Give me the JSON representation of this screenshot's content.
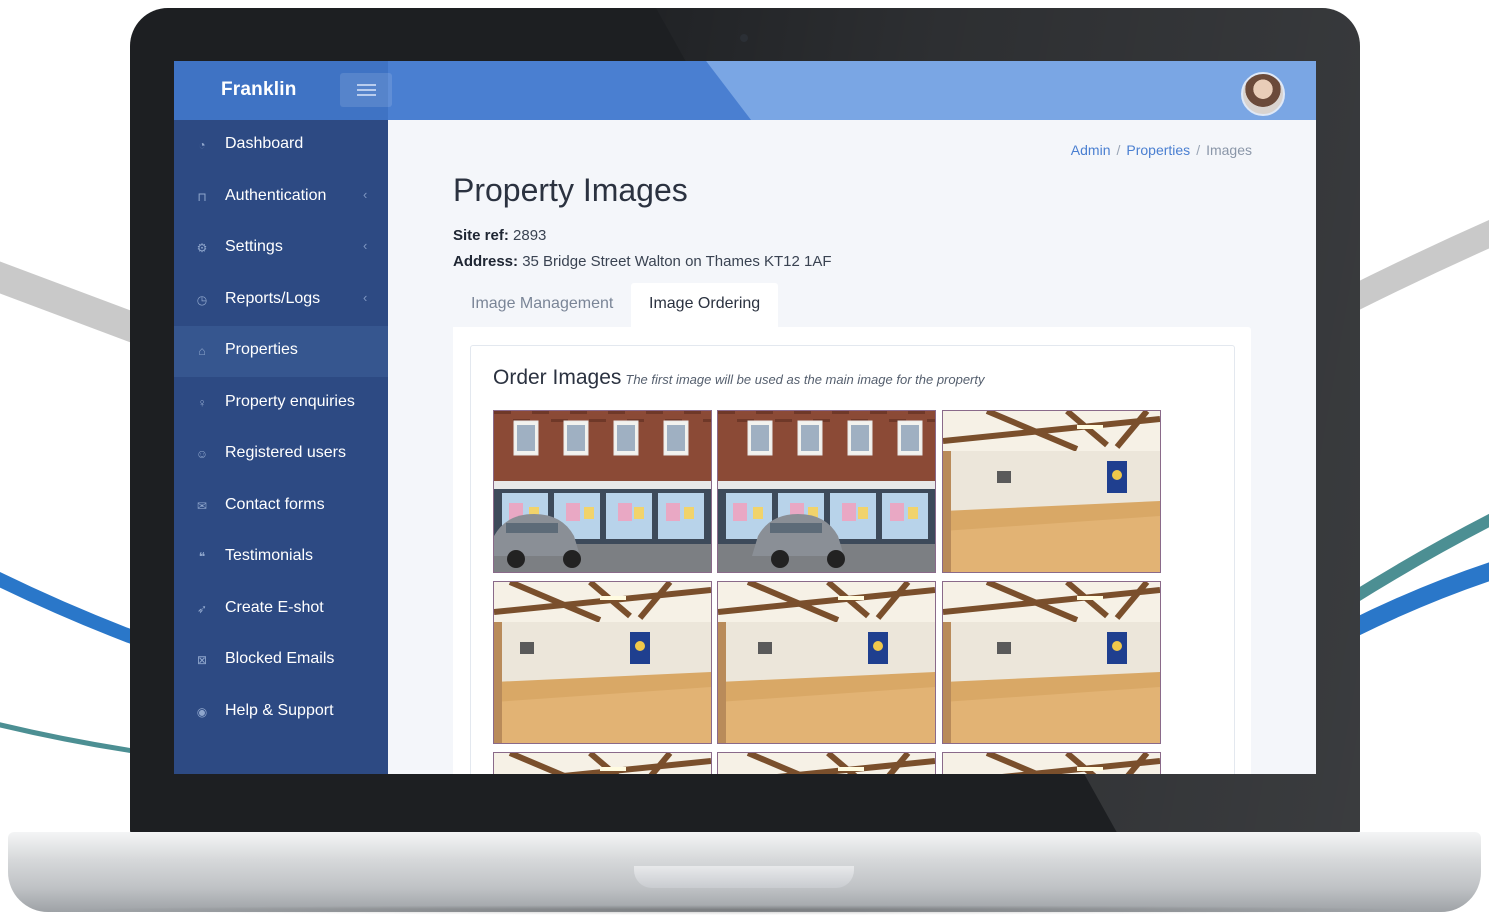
{
  "app": {
    "brand": "Franklin"
  },
  "sidebar": {
    "items": [
      {
        "label": "Dashboard",
        "icon": "dashboard-icon",
        "glyph": "◔",
        "chevron": false,
        "active": false
      },
      {
        "label": "Authentication",
        "icon": "lock-icon",
        "glyph": "⊓",
        "chevron": true,
        "active": false
      },
      {
        "label": "Settings",
        "icon": "gear-icon",
        "glyph": "⚙",
        "chevron": true,
        "active": false
      },
      {
        "label": "Reports/Logs",
        "icon": "clock-icon",
        "glyph": "◷",
        "chevron": true,
        "active": false
      },
      {
        "label": "Properties",
        "icon": "home-icon",
        "glyph": "⌂",
        "chevron": false,
        "active": true
      },
      {
        "label": "Property enquiries",
        "icon": "lightbulb-icon",
        "glyph": "♀",
        "chevron": false,
        "active": false
      },
      {
        "label": "Registered users",
        "icon": "smiley-icon",
        "glyph": "☺",
        "chevron": false,
        "active": false
      },
      {
        "label": "Contact forms",
        "icon": "envelope-icon",
        "glyph": "✉",
        "chevron": false,
        "active": false
      },
      {
        "label": "Testimonials",
        "icon": "quote-icon",
        "glyph": "❝",
        "chevron": false,
        "active": false
      },
      {
        "label": "Create E-shot",
        "icon": "rocket-icon",
        "glyph": "➶",
        "chevron": false,
        "active": false
      },
      {
        "label": "Blocked Emails",
        "icon": "mail-block-icon",
        "glyph": "⊠",
        "chevron": false,
        "active": false
      },
      {
        "label": "Help & Support",
        "icon": "help-icon",
        "glyph": "◉",
        "chevron": false,
        "active": false
      }
    ]
  },
  "breadcrumb": {
    "admin": "Admin",
    "properties": "Properties",
    "current": "Images",
    "separator": "/"
  },
  "page": {
    "title": "Property Images",
    "site_ref_label": "Site ref:",
    "site_ref_value": "2893",
    "address_label": "Address:",
    "address_value": "35 Bridge Street Walton on Thames KT12 1AF"
  },
  "tabs": [
    {
      "label": "Image Management",
      "active": false
    },
    {
      "label": "Image Ordering",
      "active": true
    }
  ],
  "ordering": {
    "title": "Order Images",
    "hint": "The first image will be used as the main image for the property",
    "images": [
      {
        "kind": "storefront-1",
        "icon": "photo-storefront-icon"
      },
      {
        "kind": "storefront-2",
        "icon": "photo-storefront-icon"
      },
      {
        "kind": "hall",
        "icon": "photo-hall-icon"
      },
      {
        "kind": "hall",
        "icon": "photo-hall-icon"
      },
      {
        "kind": "hall",
        "icon": "photo-hall-icon"
      },
      {
        "kind": "hall",
        "icon": "photo-hall-icon"
      },
      {
        "kind": "hall",
        "icon": "photo-hall-icon"
      },
      {
        "kind": "hall",
        "icon": "photo-hall-icon"
      },
      {
        "kind": "hall",
        "icon": "photo-hall-icon"
      }
    ]
  },
  "colors": {
    "topbar": "#4a7fd1",
    "sidebar": "#2d4a83",
    "sidebar_active": "#36568f",
    "accent": "#4a7fd1"
  }
}
